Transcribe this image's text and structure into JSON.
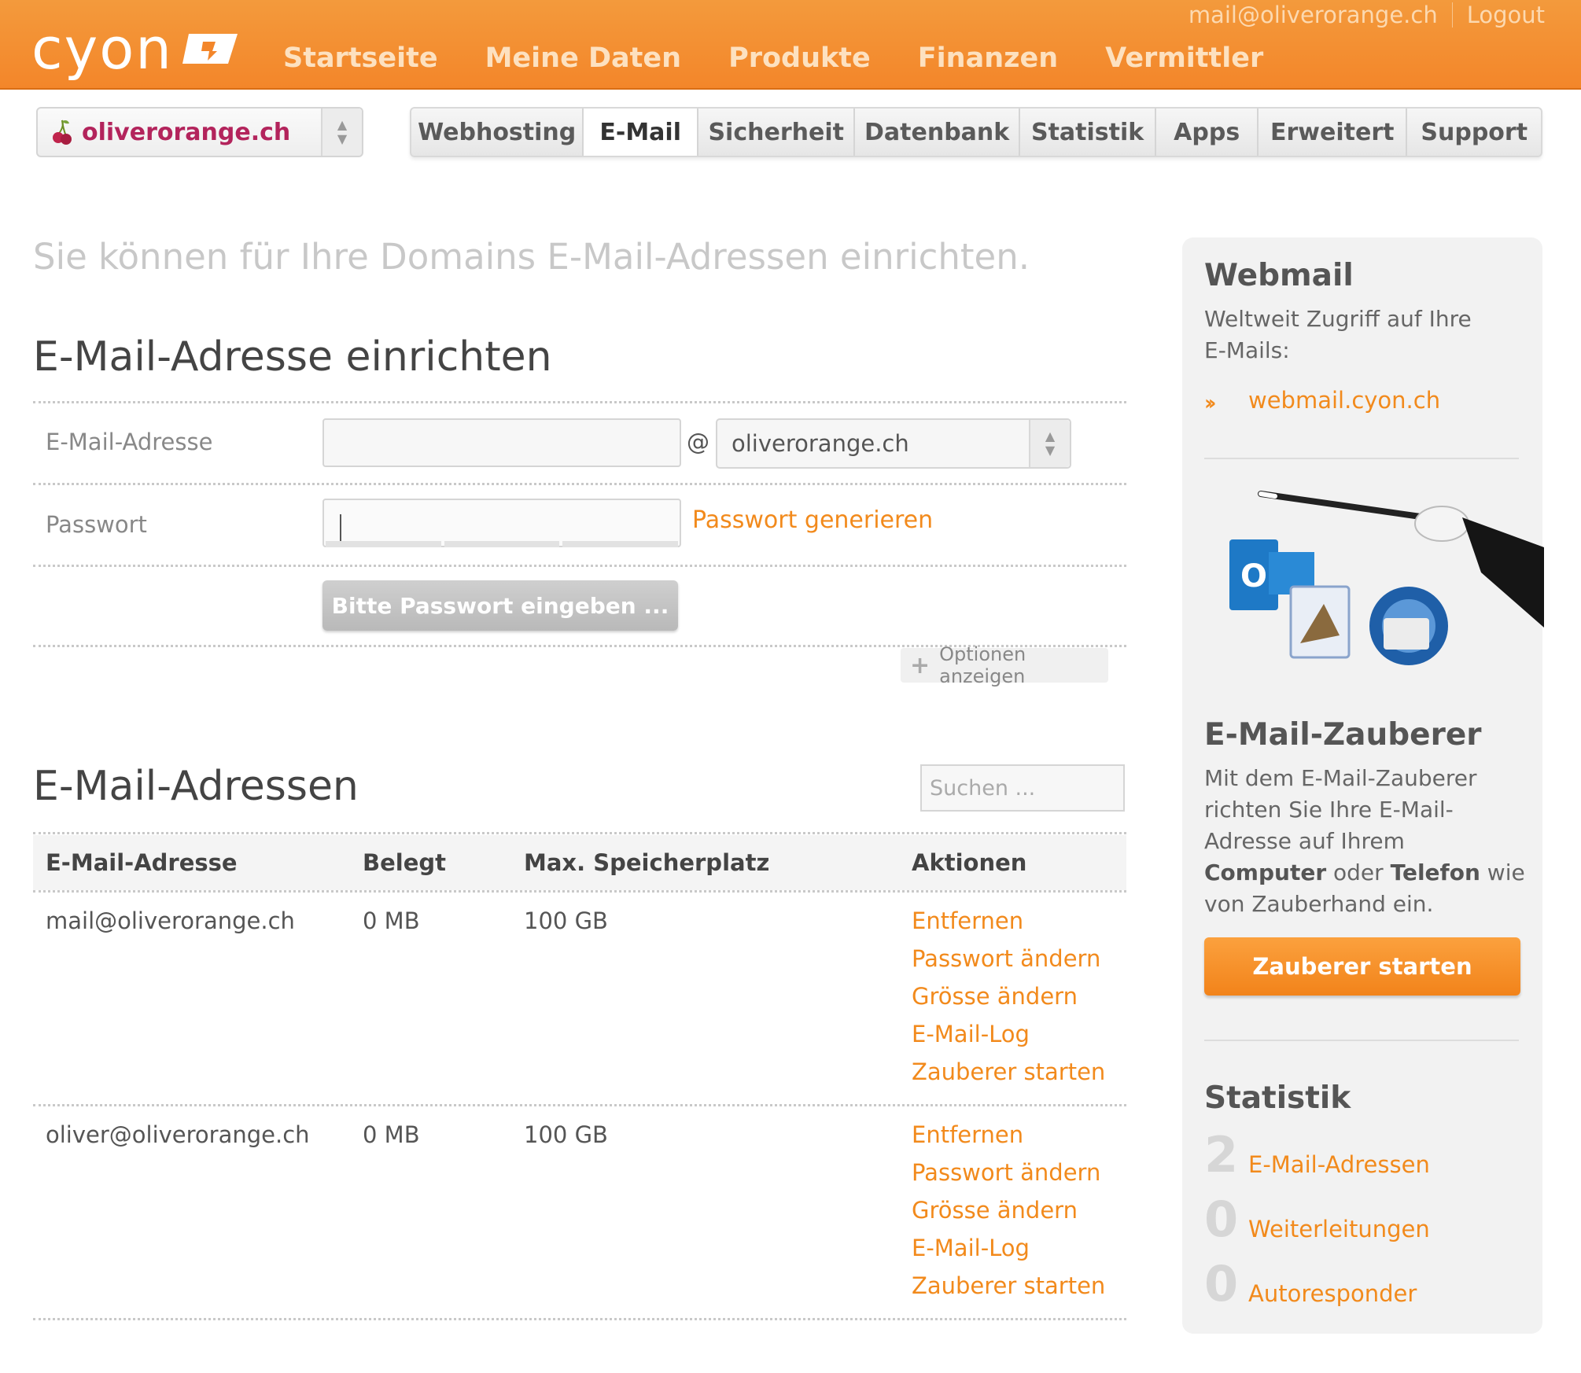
{
  "header": {
    "logo": "cyon",
    "nav": [
      "Startseite",
      "Meine Daten",
      "Produkte",
      "Finanzen",
      "Vermittler"
    ],
    "user_email": "mail@oliverorange.ch",
    "logout": "Logout"
  },
  "domain_select": {
    "value": "oliverorange.ch"
  },
  "tabs": [
    {
      "label": "Webhosting"
    },
    {
      "label": "E-Mail",
      "active": true
    },
    {
      "label": "Sicherheit"
    },
    {
      "label": "Datenbank"
    },
    {
      "label": "Statistik"
    },
    {
      "label": "Apps"
    },
    {
      "label": "Erweitert"
    },
    {
      "label": "Support"
    }
  ],
  "main": {
    "intro": "Sie können für Ihre Domains E-Mail-Adressen einrichten.",
    "create": {
      "title": "E-Mail-Adresse einrichten",
      "email_label": "E-Mail-Adresse",
      "email_value": "",
      "at": "@",
      "domain_value": "oliverorange.ch",
      "password_label": "Passwort",
      "password_value": "",
      "generate_link": "Passwort generieren",
      "submit_label": "Bitte Passwort eingeben ...",
      "options_label": "Optionen anzeigen"
    },
    "list": {
      "title": "E-Mail-Adressen",
      "search_placeholder": "Suchen ...",
      "columns": [
        "E-Mail-Adresse",
        "Belegt",
        "Max. Speicherplatz",
        "Aktionen"
      ],
      "rows": [
        {
          "address": "mail@oliverorange.ch",
          "used": "0 MB",
          "max": "100 GB",
          "actions": [
            "Entfernen",
            "Passwort ändern",
            "Grösse ändern",
            "E-Mail-Log",
            "Zauberer starten"
          ]
        },
        {
          "address": "oliver@oliverorange.ch",
          "used": "0 MB",
          "max": "100 GB",
          "actions": [
            "Entfernen",
            "Passwort ändern",
            "Grösse ändern",
            "E-Mail-Log",
            "Zauberer starten"
          ]
        }
      ]
    }
  },
  "sidebar": {
    "webmail": {
      "title": "Webmail",
      "text": "Weltweit Zugriff auf Ihre E-Mails:",
      "link": "webmail.cyon.ch"
    },
    "wizard": {
      "title": "E-Mail-Zauberer",
      "text_1": "Mit dem E-Mail-Zauberer richten Sie Ihre E-Mail-Adresse auf Ihrem ",
      "text_bold_1": "Computer",
      "text_2": " oder ",
      "text_bold_2": "Telefon",
      "text_3": " wie von Zauberhand ein.",
      "button": "Zauberer starten"
    },
    "stats": {
      "title": "Statistik",
      "items": [
        {
          "count": "2",
          "label": "E-Mail-Adressen"
        },
        {
          "count": "0",
          "label": "Weiterleitungen"
        },
        {
          "count": "0",
          "label": "Autoresponder"
        }
      ]
    }
  },
  "colors": {
    "brand_orange": "#f28a1c",
    "domain_magenta": "#b3245c"
  },
  "icons": [
    "cyon-logo-mark",
    "cherry-icon",
    "select-arrows-icon",
    "plus-icon",
    "double-chevron-icon",
    "mail-apps-illustration"
  ]
}
